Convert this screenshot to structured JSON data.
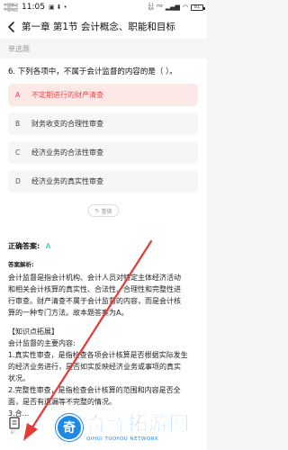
{
  "status_bar": {
    "carrier_lines": [
      "中国移动",
      "中国电信"
    ],
    "time": "11:05",
    "net_speed": [
      "3.1",
      "K/s"
    ],
    "battery": "81"
  },
  "header": {
    "title": "第一章 第1节 会计概念、职能和目标"
  },
  "question_type": "单选题",
  "question": {
    "text": "6. 下列各项中，不属于会计监督的内容的是（    ）。",
    "options": [
      {
        "letter": "A",
        "text": "不定期进行的财产清查",
        "state": "wrong"
      },
      {
        "letter": "B",
        "text": "财务收支的合理性审查",
        "state": "normal"
      },
      {
        "letter": "C",
        "text": "经济业务的合法性审查",
        "state": "normal"
      },
      {
        "letter": "D",
        "text": "经济业务的真实性审查",
        "state": "normal"
      }
    ],
    "redo_label": "重做"
  },
  "answer": {
    "correct_label": "正确答案:",
    "correct_value": "A",
    "analysis_label": "答案解析:",
    "lines": [
      "会计监督是指会计机构、会计人员对特定主体经济活动",
      "和相关会计核算的真实性、合法性、合理性和完整性进",
      "行审查。财产清查不属于会计监督的内容，而是会计核",
      "算的一种专门方法。故本题答案为A。",
      "",
      "【知识点拓展】",
      "会计监督的主要内容:",
      "1.真实性审查，是指检查各项会计核算是否根据实际发生",
      "的经济业务进行，是否如实反映经济业务或事项的真实",
      "状况。",
      "2.完整性审查，是指检查会计核算的范围和内容是否全",
      "面，是否有遗漏等不完整的情况。",
      "3.合..."
    ]
  },
  "bottom_bar": {
    "label": "8/..."
  },
  "watermark": {
    "cn": "奇辉拓游网",
    "en": "QIHUI TUOYOU NETWORK",
    "mark": "奇"
  },
  "colors": {
    "wrong": "#e24b4b",
    "correct": "#2fb8a0",
    "annotation": "#e53935",
    "watermark": "#1e88e5"
  }
}
